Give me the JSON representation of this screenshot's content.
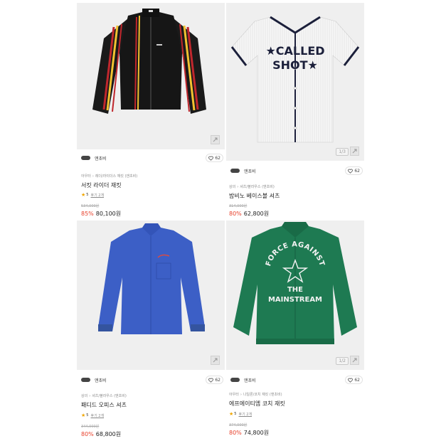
{
  "products": [
    {
      "brand": "앤초비",
      "likes": "62",
      "crumbs": [
        "아우터",
        "레더/라이더스 재킷",
        "(앤초비)"
      ],
      "name": "서킷 라이더 재킷",
      "rating": "5",
      "reviews": "후기 2개",
      "original_price": "534,000원",
      "discount": "85%",
      "price": "80,100원",
      "image_badge": "",
      "garment": "black-rider-jacket"
    },
    {
      "brand": "앤초비",
      "likes": "62",
      "crumbs": [
        "상의",
        "셔츠/블라우스",
        "(앤초비)"
      ],
      "name": "밤비노 베이스볼 셔츠",
      "rating": "",
      "reviews": "",
      "original_price": "314,000원",
      "discount": "80%",
      "price": "62,800원",
      "image_badge": "1/3",
      "garment": "white-baseball-shirt",
      "graphic_text": [
        "★CALLED",
        "SHOT★"
      ]
    },
    {
      "brand": "앤초비",
      "likes": "62",
      "crumbs": [
        "상의",
        "셔츠/블라우스",
        "(앤초비)"
      ],
      "name": "패디드 오피스 셔츠",
      "rating": "5",
      "reviews": "후기 2개",
      "original_price": "344,000원",
      "discount": "80%",
      "price": "68,800원",
      "image_badge": "",
      "garment": "blue-office-shirt"
    },
    {
      "brand": "앤초비",
      "likes": "62",
      "crumbs": [
        "아우터",
        "나일론/코치 재킷",
        "(앤초비)"
      ],
      "name": "에프에이티엠 코치 재킷",
      "rating": "5",
      "reviews": "후기 2개",
      "original_price": "374,000원",
      "discount": "80%",
      "price": "74,800원",
      "image_badge": "1/2",
      "garment": "green-coach-jacket",
      "graphic_text": [
        "FORCE AGAINST",
        "THE",
        "MAINSTREAM"
      ]
    }
  ],
  "colors": {
    "discount": "#e8412c",
    "star": "#f0a600",
    "image_bg": "#efefef",
    "jacket_black": "#1a1a1a",
    "shirt_blue": "#3c5fc6",
    "jacket_green": "#1e7a52"
  },
  "icons": [
    "expand-icon",
    "heart-icon",
    "star-icon",
    "brand-logo"
  ]
}
